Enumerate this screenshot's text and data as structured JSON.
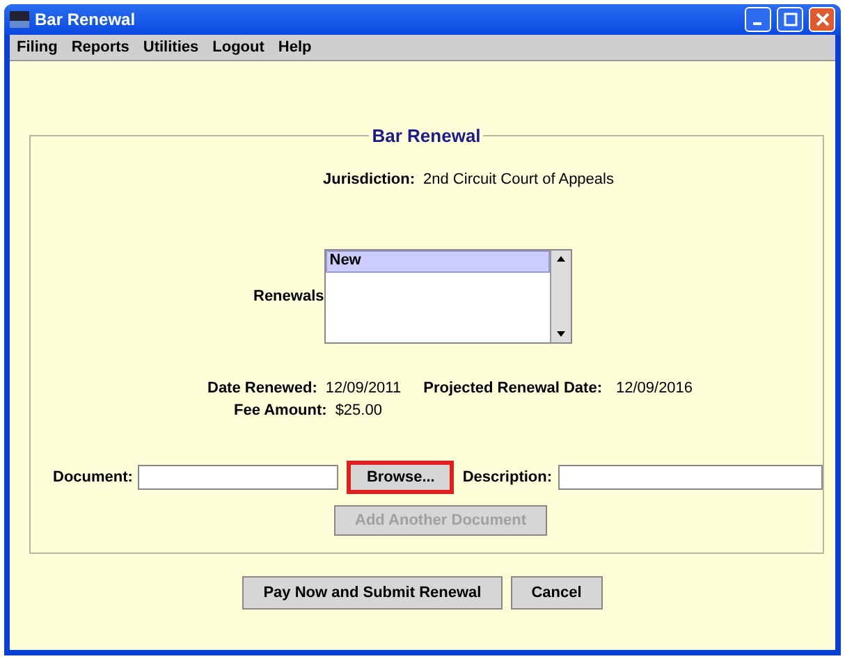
{
  "window": {
    "title": "Bar Renewal"
  },
  "menu": [
    "Filing",
    "Reports",
    "Utilities",
    "Logout",
    "Help"
  ],
  "form": {
    "legend": "Bar Renewal",
    "jurisdiction": {
      "label": "Jurisdiction:",
      "value": "2nd Circuit Court of Appeals"
    },
    "renewals": {
      "label": "Renewals",
      "items": [
        {
          "label": "New",
          "selected": true
        }
      ]
    },
    "date_renewed": {
      "label": "Date Renewed:",
      "value": "12/09/2011"
    },
    "projected": {
      "label": "Projected Renewal Date:",
      "value": "12/09/2016"
    },
    "fee": {
      "label": "Fee Amount:",
      "value": "$25.00"
    },
    "document": {
      "label": "Document:"
    },
    "browse": {
      "label": "Browse...",
      "highlighted": true
    },
    "description": {
      "label": "Description:"
    },
    "add_document": {
      "label": "Add Another Document",
      "disabled": true
    }
  },
  "buttons": [
    {
      "label": "Pay Now and Submit Renewal"
    },
    {
      "label": "Cancel"
    }
  ]
}
